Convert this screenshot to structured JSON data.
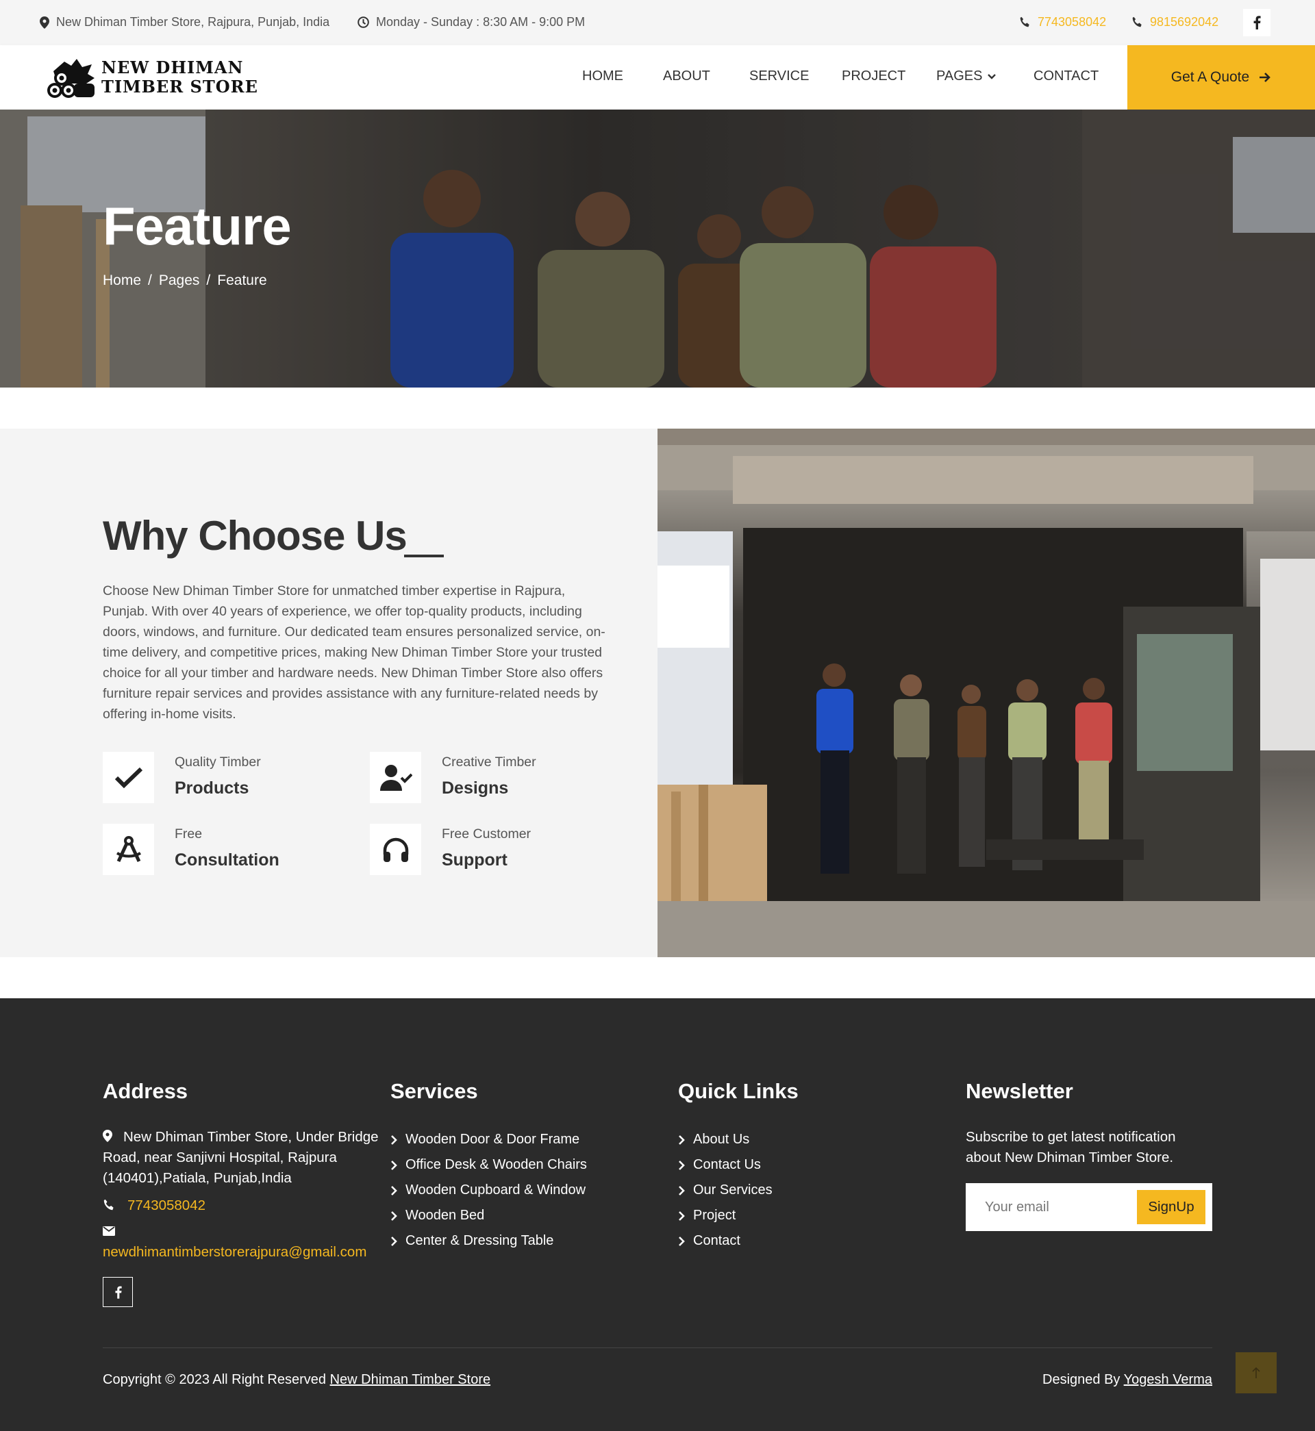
{
  "topbar": {
    "address": "New Dhiman Timber Store, Rajpura, Punjab, India",
    "hours": "Monday - Sunday : 8:30 AM - 9:00 PM",
    "phone1": "7743058042",
    "phone2": "9815692042"
  },
  "brand": {
    "line1": "NEW DHIMAN",
    "line2": "TIMBER STORE"
  },
  "nav": {
    "items": [
      "HOME",
      "ABOUT",
      "SERVICE",
      "PROJECT",
      "PAGES",
      "CONTACT"
    ],
    "quote_label": "Get A Quote"
  },
  "hero": {
    "title": "Feature",
    "breadcrumbs": [
      "Home",
      "Pages",
      "Feature"
    ]
  },
  "why": {
    "title": "Why Choose Us",
    "text": "Choose New Dhiman Timber Store for unmatched timber expertise in Rajpura, Punjab. With over 40 years of experience, we offer top-quality products, including doors, windows, and furniture. Our dedicated team ensures personalized service, on-time delivery, and competitive prices, making New Dhiman Timber Store your trusted choice for all your timber and hardware needs. New Dhiman Timber Store also offers furniture repair services and provides assistance with any furniture-related needs by offering in-home visits.",
    "features": [
      {
        "small": "Quality Timber",
        "big": "Products",
        "icon": "check-icon"
      },
      {
        "small": "Creative Timber",
        "big": "Designs",
        "icon": "user-check-icon"
      },
      {
        "small": "Free",
        "big": "Consultation",
        "icon": "compass-drafting-icon"
      },
      {
        "small": "Free Customer",
        "big": "Support",
        "icon": "headphones-icon"
      }
    ]
  },
  "footer": {
    "address_title": "Address",
    "address": "New Dhiman Timber Store, Under Bridge Road, near Sanjivni Hospital, Rajpura (140401),Patiala, Punjab,India",
    "phone": "7743058042",
    "email": "newdhimantimberstorerajpura@gmail.com",
    "services_title": "Services",
    "services": [
      "Wooden Door & Door Frame",
      "Office Desk & Wooden Chairs",
      "Wooden Cupboard & Window",
      "Wooden Bed",
      "Center & Dressing Table"
    ],
    "links_title": "Quick Links",
    "links": [
      "About Us",
      "Contact Us",
      "Our Services",
      "Project",
      "Contact"
    ],
    "newsletter_title": "Newsletter",
    "newsletter_text": "Subscribe to get latest notification about New Dhiman Timber Store.",
    "email_placeholder": "Your email",
    "signup_label": "SignUp",
    "copyright_prefix": "Copyright © 2023 All Right Reserved",
    "copyright_link": "New Dhiman Timber Store",
    "designed_prefix": "Designed By",
    "designed_link": "Yogesh Verma"
  },
  "colors": {
    "accent": "#f5b820",
    "footer_bg": "#2b2b2b",
    "topbar_bg": "#f5f5f5"
  }
}
